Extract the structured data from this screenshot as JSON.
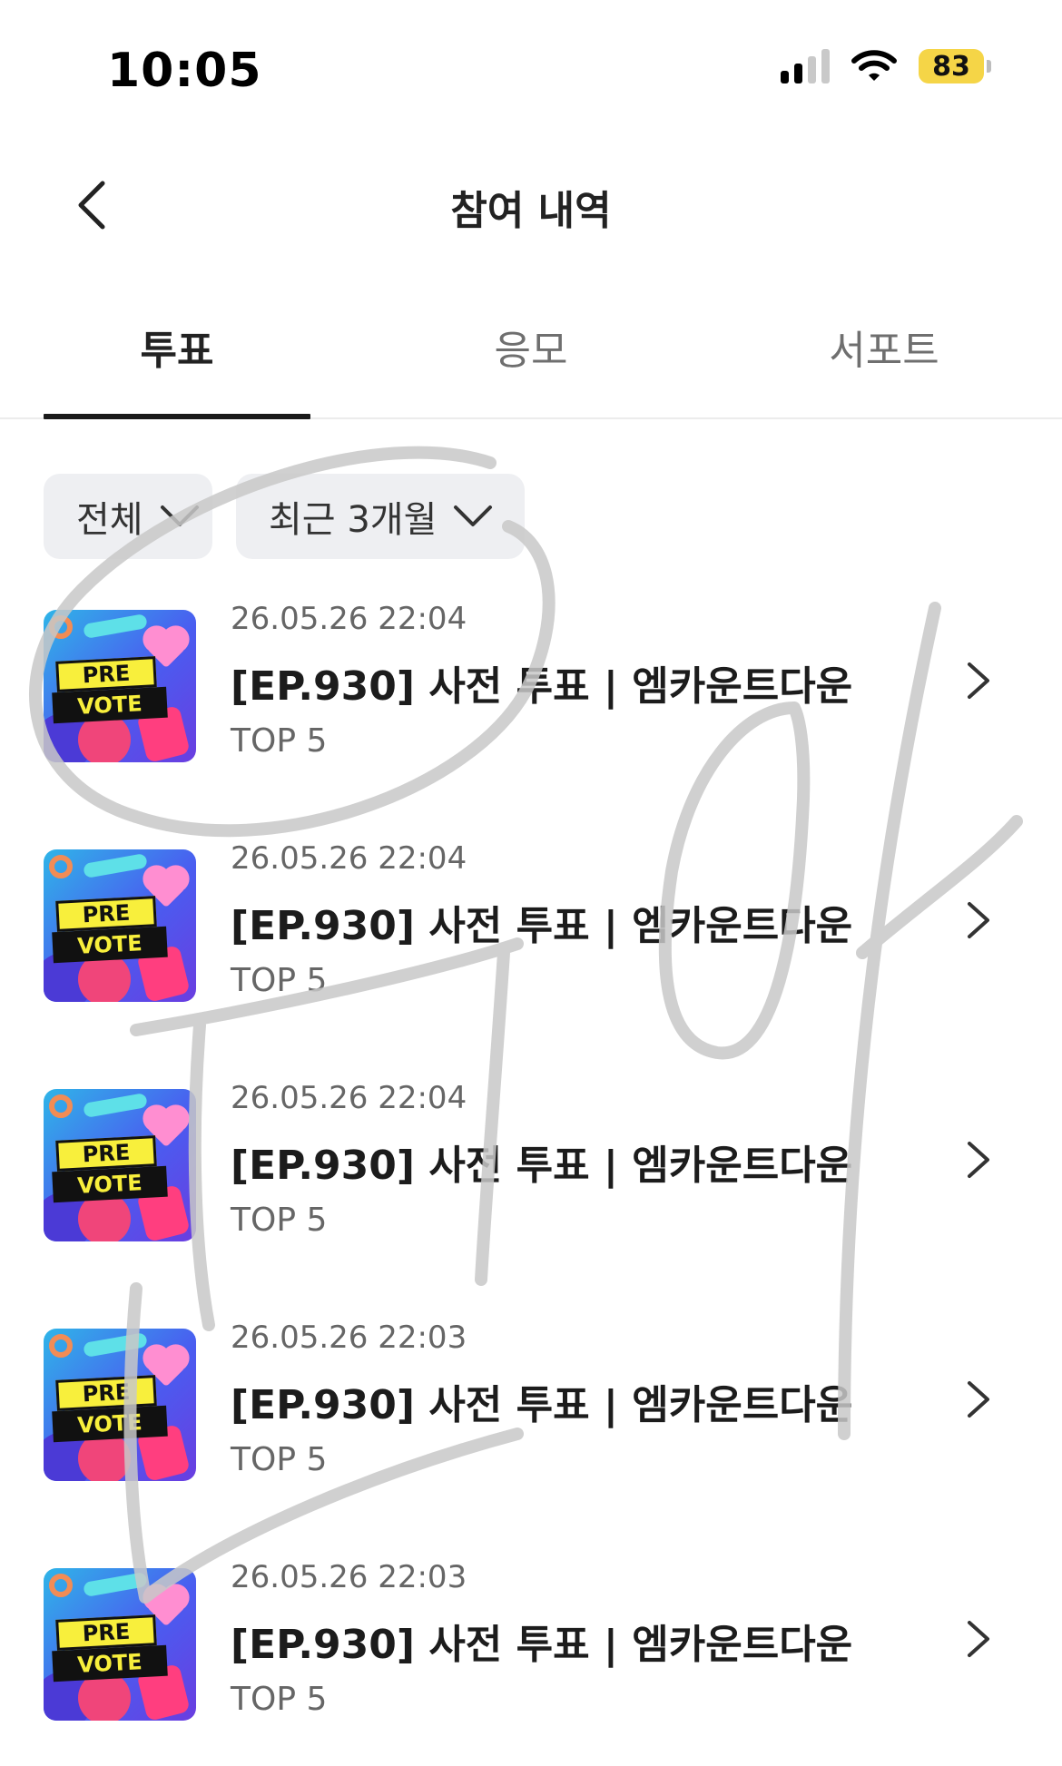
{
  "status_bar": {
    "time": "10:05",
    "battery": "83"
  },
  "header": {
    "title": "참여 내역",
    "back_icon": "chevron-left-icon"
  },
  "tabs": [
    {
      "label": "투표",
      "active": true
    },
    {
      "label": "응모",
      "active": false
    },
    {
      "label": "서포트",
      "active": false
    }
  ],
  "filters": [
    {
      "label": "전체",
      "icon": "chevron-down-icon"
    },
    {
      "label": "최근 3개월",
      "icon": "chevron-down-icon"
    }
  ],
  "thumbnail": {
    "line1": "PRE",
    "line2": "VOTE"
  },
  "items": [
    {
      "date": "26.05.26 22:04",
      "title": "[EP.930] 사전 투표 | 엠카운트다운",
      "rank": "TOP 5"
    },
    {
      "date": "26.05.26 22:04",
      "title": "[EP.930] 사전 투표 | 엠카운트다운",
      "rank": "TOP 5"
    },
    {
      "date": "26.05.26 22:04",
      "title": "[EP.930] 사전 투표 | 엠카운트다운",
      "rank": "TOP 5"
    },
    {
      "date": "26.05.26 22:03",
      "title": "[EP.930] 사전 투표 | 엠카운트다운",
      "rank": "TOP 5"
    },
    {
      "date": "26.05.26 22:03",
      "title": "[EP.930] 사전 투표 | 엠카운트다운",
      "rank": "TOP 5"
    }
  ],
  "colors": {
    "active_tab": "#1a1a1a",
    "chip_bg": "#eeeff2",
    "battery": "#f5d547"
  }
}
